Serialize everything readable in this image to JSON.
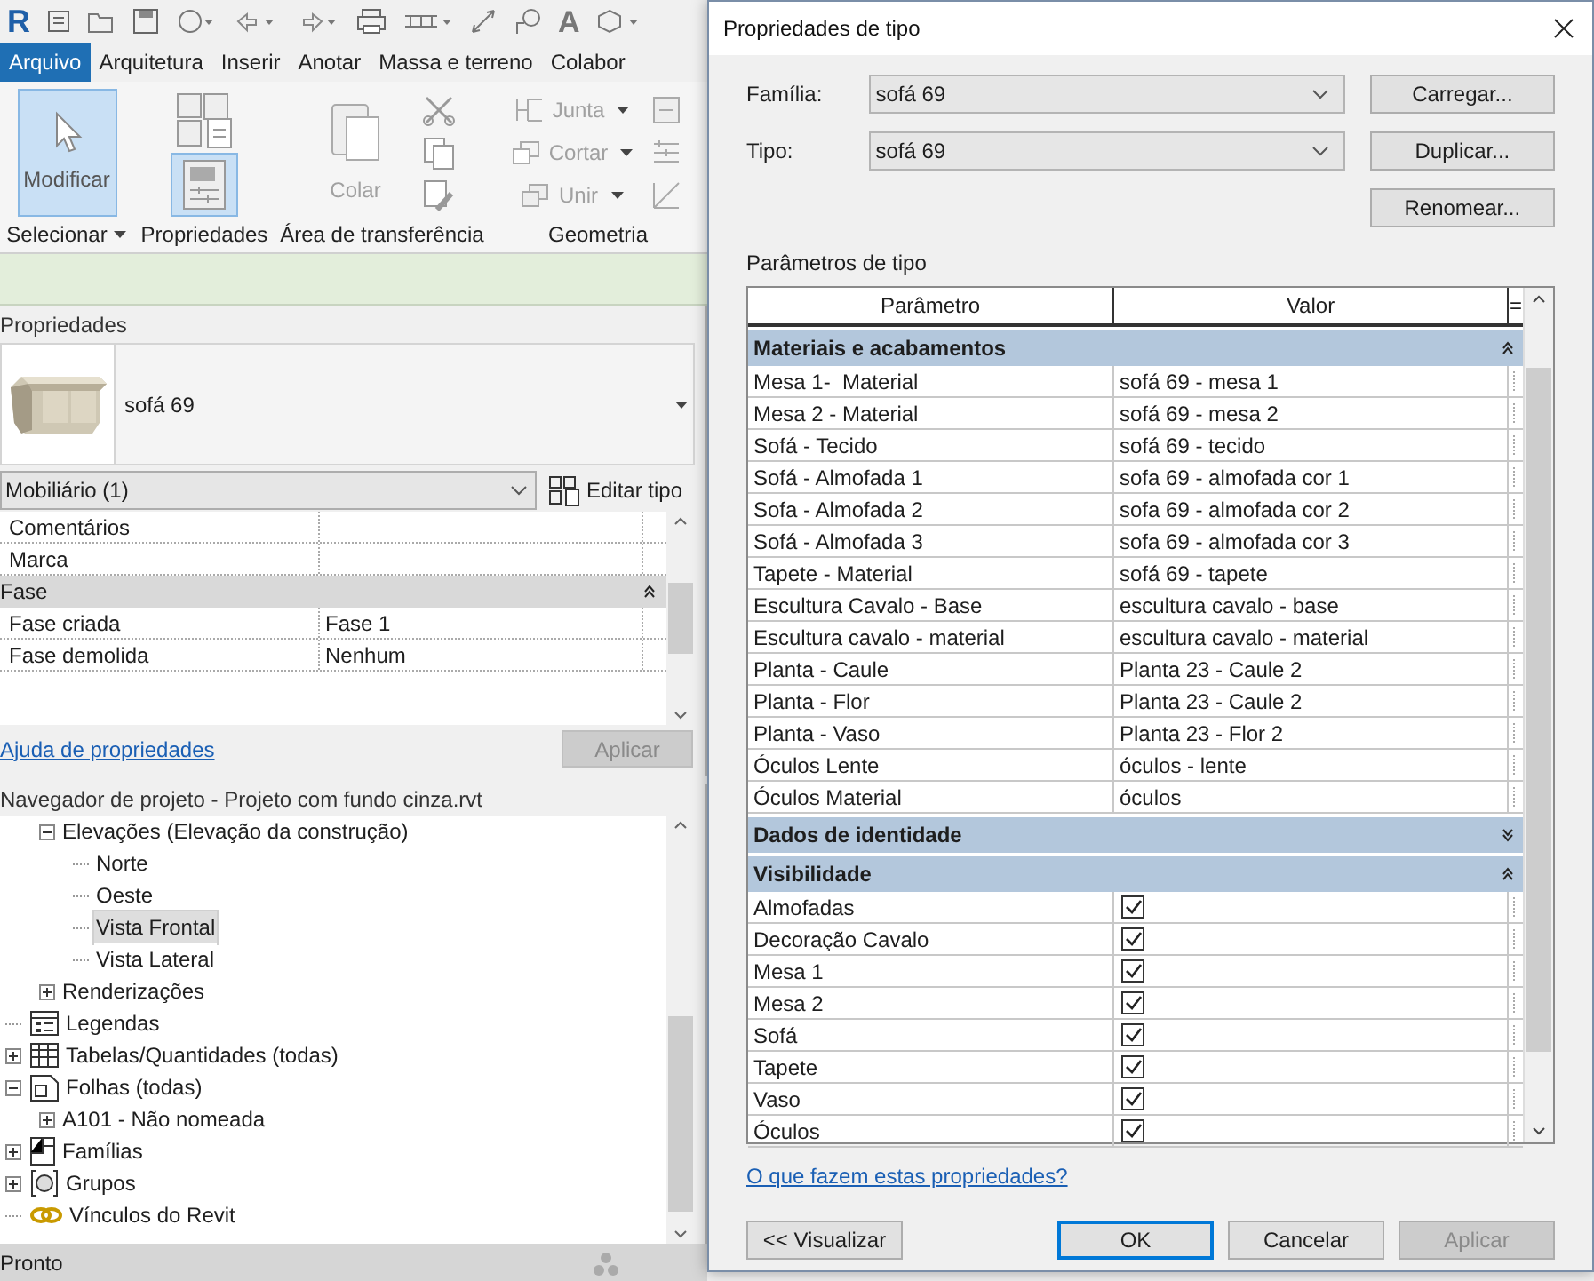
{
  "quick_access_toolbar": {
    "logo": "R",
    "text_glyph": "A"
  },
  "ribbon_tabs": [
    {
      "label": "Arquivo",
      "selected": true
    },
    {
      "label": "Arquitetura",
      "selected": false
    },
    {
      "label": "Inserir",
      "selected": false
    },
    {
      "label": "Anotar",
      "selected": false
    },
    {
      "label": "Massa e terreno",
      "selected": false
    },
    {
      "label": "Colabor",
      "selected": false
    }
  ],
  "ribbon_panels": [
    {
      "label": "Selecionar",
      "has_menu": true,
      "tools": [
        {
          "kind": "large",
          "label": "Modificar",
          "selected": true
        }
      ]
    },
    {
      "label": "Propriedades",
      "tools": [
        {
          "kind": "icon",
          "selected": false
        },
        {
          "kind": "icon",
          "selected": true
        }
      ]
    },
    {
      "label": "Área de transferência",
      "tools": [
        {
          "kind": "large",
          "label": "Colar",
          "disabled": true
        },
        {
          "kind": "icon",
          "selected": false
        },
        {
          "kind": "icon",
          "selected": false
        },
        {
          "kind": "icon",
          "selected": false
        }
      ]
    },
    {
      "label": "Geometria",
      "tools": [
        {
          "kind": "small",
          "label": "Junta",
          "disabled": true
        },
        {
          "kind": "small",
          "label": "Cortar",
          "disabled": true
        },
        {
          "kind": "small",
          "label": "Unir",
          "disabled": true
        },
        {
          "kind": "icon",
          "selected": false
        },
        {
          "kind": "icon",
          "selected": false
        },
        {
          "kind": "icon",
          "selected": false
        }
      ]
    }
  ],
  "properties_panel": {
    "title": "Propriedades",
    "type_name": "sofá 69",
    "category": "Mobiliário (1)",
    "edit_type_button": "Editar tipo",
    "rows": [
      {
        "kind": "row",
        "name": "Comentários"
      },
      {
        "kind": "row",
        "name": "Marca"
      },
      {
        "kind": "group",
        "label": "Fase",
        "expanded": true
      },
      {
        "kind": "row",
        "name": "Fase criada",
        "value": "Fase 1"
      },
      {
        "kind": "row",
        "name": "Fase demolida",
        "value": "Nenhum"
      }
    ],
    "help_link": "Ajuda de propriedades",
    "apply_button": {
      "label": "Aplicar",
      "disabled": true
    }
  },
  "project_browser": {
    "title": "Navegador de projeto - Projeto com fundo cinza.rvt",
    "tree": [
      {
        "children": [
          {
            "label": "Elevações (Elevação da construção)",
            "expanded": true,
            "selected": false,
            "children": [
              {
                "label": "Norte",
                "selected": false
              },
              {
                "label": "Oeste",
                "selected": false
              },
              {
                "label": "Vista Frontal",
                "selected": true
              },
              {
                "label": "Vista Lateral",
                "selected": false
              }
            ]
          },
          {
            "label": "Renderizações",
            "expanded": false,
            "selected": false
          }
        ]
      },
      {
        "label": "Legendas",
        "kind": "legend",
        "selected": false
      },
      {
        "label": "Tabelas/Quantidades (todas)",
        "kind": "table",
        "expanded": false,
        "selected": false
      },
      {
        "label": "Folhas (todas)",
        "kind": "sheet",
        "expanded": true,
        "selected": false,
        "children": [
          {
            "label": "A101 - Não nomeada",
            "expanded": false,
            "selected": false
          }
        ]
      },
      {
        "label": "Famílias",
        "kind": "family",
        "expanded": false,
        "selected": false
      },
      {
        "label": "Grupos",
        "kind": "group",
        "expanded": false,
        "selected": false
      },
      {
        "label": "Vínculos do Revit",
        "kind": "link",
        "selected": false
      }
    ]
  },
  "status_bar": {
    "text": "Pronto"
  },
  "dialog": {
    "title": "Propriedades de tipo",
    "family": {
      "label": "Família:",
      "value": "sofá 69"
    },
    "type": {
      "label": "Tipo:",
      "value": "sofá 69"
    },
    "side_buttons": [
      "Carregar...",
      "Duplicar...",
      "Renomear..."
    ],
    "section_label": "Parâmetros de tipo",
    "columns": [
      "Parâmetro",
      "Valor",
      "="
    ],
    "groups": [
      {
        "label": "Materiais e acabamentos",
        "expanded": true,
        "rows": [
          {
            "kind": "text",
            "name": "Mesa 1-  Material",
            "value": "sofá 69 - mesa 1"
          },
          {
            "kind": "text",
            "name": "Mesa 2 - Material",
            "value": "sofá 69 - mesa 2"
          },
          {
            "kind": "text",
            "name": "Sofá - Tecido",
            "value": "sofá 69 - tecido"
          },
          {
            "kind": "text",
            "name": "Sofá - Almofada 1",
            "value": "sofa 69 - almofada cor 1"
          },
          {
            "kind": "text",
            "name": "Sofa - Almofada 2",
            "value": "sofa 69 - almofada cor 2"
          },
          {
            "kind": "text",
            "name": "Sofá - Almofada 3",
            "value": "sofa 69 - almofada cor 3"
          },
          {
            "kind": "text",
            "name": "Tapete - Material",
            "value": "sofá 69 - tapete"
          },
          {
            "kind": "text",
            "name": "Escultura Cavalo - Base",
            "value": "escultura cavalo - base"
          },
          {
            "kind": "text",
            "name": "Escultura cavalo - material",
            "value": "escultura cavalo - material"
          },
          {
            "kind": "text",
            "name": "Planta - Caule",
            "value": "Planta 23 - Caule 2"
          },
          {
            "kind": "text",
            "name": "Planta - Flor",
            "value": "Planta 23 - Caule 2"
          },
          {
            "kind": "text",
            "name": "Planta - Vaso",
            "value": "Planta 23 - Flor 2"
          },
          {
            "kind": "text",
            "name": "Óculos Lente",
            "value": "óculos - lente"
          },
          {
            "kind": "text",
            "name": "Óculos Material",
            "value": "óculos"
          }
        ]
      },
      {
        "label": "Dados de identidade",
        "expanded": false
      },
      {
        "label": "Visibilidade",
        "expanded": true,
        "rows": [
          {
            "kind": "checkbox",
            "name": "Almofadas",
            "checked": true
          },
          {
            "kind": "checkbox",
            "name": "Decoração Cavalo",
            "checked": true
          },
          {
            "kind": "checkbox",
            "name": "Mesa 1",
            "checked": true
          },
          {
            "kind": "checkbox",
            "name": "Mesa 2",
            "checked": true
          },
          {
            "kind": "checkbox",
            "name": "Sofá",
            "checked": true
          },
          {
            "kind": "checkbox",
            "name": "Tapete",
            "checked": true
          },
          {
            "kind": "checkbox",
            "name": "Vaso",
            "checked": true
          },
          {
            "kind": "checkbox",
            "name": "Óculos",
            "checked": true
          }
        ]
      }
    ],
    "help_link": "O que fazem estas propriedades?",
    "preview_button": "<< Visualizar",
    "buttons": [
      {
        "label": "OK",
        "kind": "default",
        "disabled": false
      },
      {
        "label": "Cancelar",
        "kind": "normal",
        "disabled": false
      },
      {
        "label": "Aplicar",
        "kind": "normal",
        "disabled": true
      }
    ]
  }
}
